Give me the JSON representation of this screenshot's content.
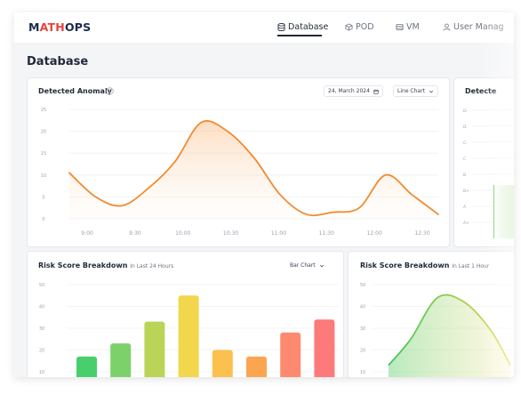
{
  "brand": {
    "part1": "M",
    "part2": "ATH",
    "part3": "OPS"
  },
  "nav": {
    "items": [
      {
        "label": "Database",
        "icon": "database-icon",
        "active": true
      },
      {
        "label": "POD",
        "icon": "cube-icon",
        "active": false
      },
      {
        "label": "VM",
        "icon": "server-icon",
        "active": false
      },
      {
        "label": "User Manag",
        "icon": "user-icon",
        "active": false
      }
    ]
  },
  "page": {
    "title": "Database"
  },
  "anomaly_card": {
    "title": "Detected Anomaly",
    "date": "24, March 2024",
    "chart_type": "Line Chart"
  },
  "grade_card": {
    "title": "Detecte",
    "grades": [
      "D-",
      "D",
      "C-",
      "C",
      "B",
      "B+",
      "A",
      "A+"
    ]
  },
  "risk24_card": {
    "title": "Risk Score Breakdown",
    "subtitle": "In Last 24 Hours",
    "chart_type": "Bar Chart"
  },
  "risk1h_card": {
    "title": "Risk Score Breakdown",
    "subtitle": "In Last 1 Hour"
  },
  "colors": {
    "accent": "#f28a30",
    "brand_red": "#e8443a",
    "navy": "#1a2a4a"
  },
  "chart_data": [
    {
      "type": "area",
      "x": [
        "9:00",
        "9:15",
        "9:30",
        "9:45",
        "10:00",
        "10:15",
        "10:30",
        "10:45",
        "11:00",
        "11:15",
        "11:30",
        "11:45",
        "12:00",
        "12:15",
        "12:30"
      ],
      "values": [
        10.5,
        5,
        3,
        7,
        13,
        22,
        20,
        14,
        5.5,
        1,
        1.5,
        2.5,
        10,
        5.5,
        1
      ],
      "xlabels": [
        "9:00",
        "9:30",
        "10:00",
        "10:30",
        "11:00",
        "11:30",
        "12:00",
        "12:30"
      ],
      "yticks": [
        0,
        5,
        10,
        15,
        20,
        25
      ],
      "ylim": [
        0,
        25
      ],
      "grid": true
    },
    {
      "type": "bar",
      "values": [
        17,
        23,
        33,
        45,
        20,
        17,
        28,
        34
      ],
      "colors": [
        "#48cf6b",
        "#7dd16a",
        "#b9d457",
        "#f2d64b",
        "#fcc04f",
        "#fca550",
        "#fd8a6f",
        "#fd7a7a"
      ],
      "yticks": [
        10,
        20,
        30,
        40,
        50
      ],
      "ylim": [
        10,
        50
      ],
      "grid": true
    },
    {
      "type": "area",
      "values": [
        13,
        25,
        44,
        42,
        29,
        13
      ],
      "yticks": [
        10,
        20,
        30,
        40,
        50
      ],
      "ylim": [
        10,
        50
      ],
      "grid": true
    }
  ]
}
